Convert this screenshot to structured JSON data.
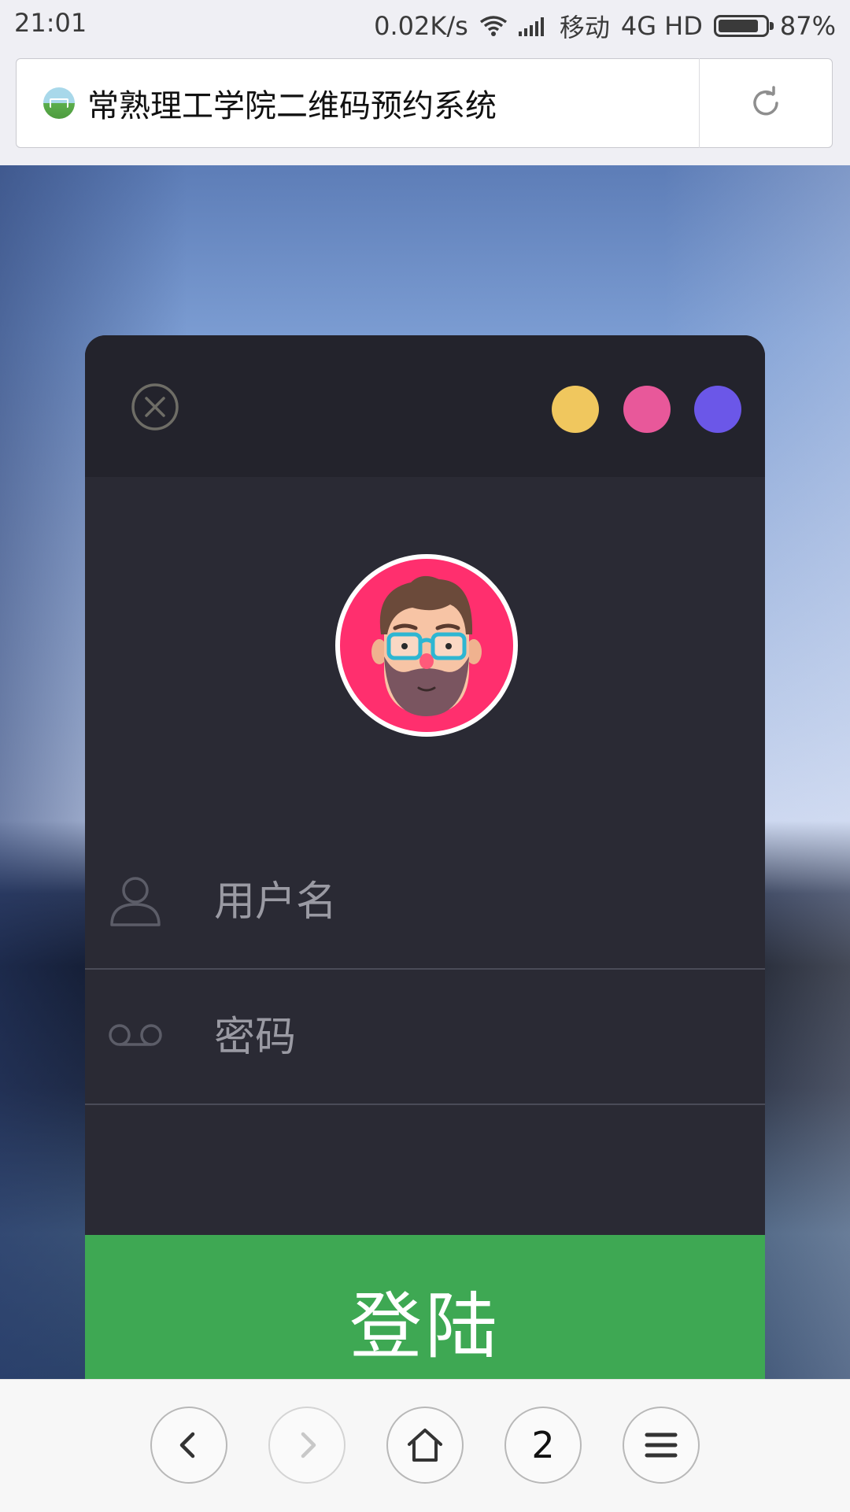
{
  "status_bar": {
    "time": "21:01",
    "network_speed": "0.02K/s",
    "carrier": "移动",
    "network_type": "4G HD",
    "battery_percent": "87%",
    "battery_level": 0.87
  },
  "address_bar": {
    "favicon": "site-favicon",
    "title": "常熟理工学院二维码预约系统",
    "reload_icon": "reload-icon"
  },
  "login_panel": {
    "close_icon": "close-circle-icon",
    "theme_colors": [
      "#f0c75e",
      "#e8589a",
      "#6b57e8"
    ],
    "avatar": "bearded-man-avatar",
    "username_placeholder": "用户名",
    "password_placeholder": "密码",
    "login_label": "登陆",
    "login_color": "#3ea853"
  },
  "bottom_bar": {
    "back_icon": "chevron-left-icon",
    "forward_icon": "chevron-right-icon",
    "home_icon": "home-icon",
    "tab_count": "2",
    "menu_icon": "hamburger-menu-icon"
  }
}
